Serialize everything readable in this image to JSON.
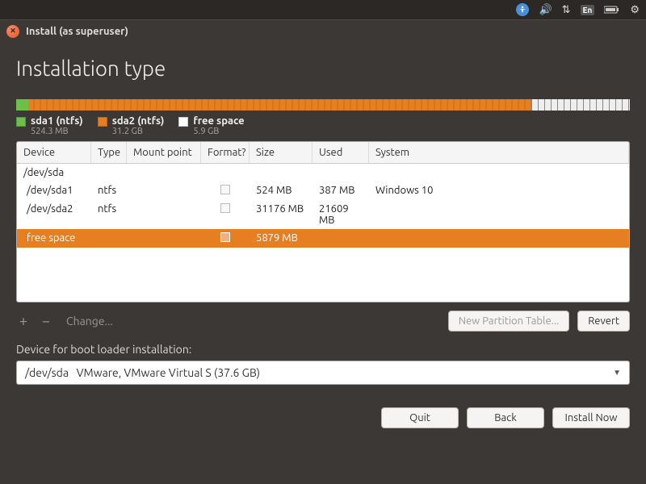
{
  "window": {
    "title": "Install (as superuser)"
  },
  "page_title": "Installation type",
  "barsegs": {
    "green_pct": 2,
    "orange_pct": 82,
    "free_pct": 16
  },
  "legend": [
    {
      "swatch": "g",
      "label": "sda1 (ntfs)",
      "sub": "524.3 MB"
    },
    {
      "swatch": "o",
      "label": "sda2 (ntfs)",
      "sub": "31.2 GB"
    },
    {
      "swatch": "f",
      "label": "free space",
      "sub": "5.9 GB"
    }
  ],
  "columns": {
    "device": "Device",
    "type": "Type",
    "mount": "Mount point",
    "format": "Format?",
    "size": "Size",
    "used": "Used",
    "system": "System"
  },
  "rows": {
    "parent": {
      "device": "/dev/sda"
    },
    "r1": {
      "device": "/dev/sda1",
      "type": "ntfs",
      "size": "524 MB",
      "used": "387 MB",
      "system": "Windows 10"
    },
    "r2": {
      "device": "/dev/sda2",
      "type": "ntfs",
      "size": "31176 MB",
      "used": "21609 MB",
      "system": ""
    },
    "r3": {
      "device": "free space",
      "size": "5879 MB"
    }
  },
  "toolbar": {
    "add": "+",
    "remove": "−",
    "change": "Change...",
    "new_table": "New Partition Table...",
    "revert": "Revert"
  },
  "boot": {
    "label": "Device for boot loader installation:",
    "value": "/dev/sda   VMware, VMware Virtual S (37.6 GB)"
  },
  "footer": {
    "quit": "Quit",
    "back": "Back",
    "install": "Install Now"
  },
  "tray": {
    "lang": "En"
  }
}
